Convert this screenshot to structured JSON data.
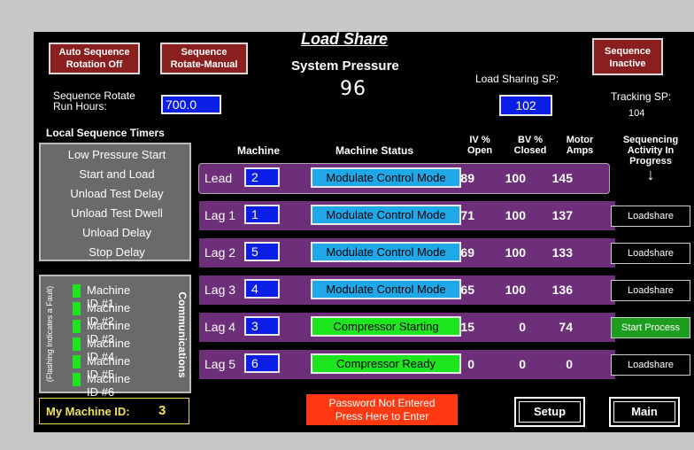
{
  "top_buttons": {
    "auto_sequence": [
      "Auto Sequence",
      "Rotation Off"
    ],
    "sequence_rotate": [
      "Sequence",
      "Rotate-Manual"
    ],
    "sequence_inactive": [
      "Sequence",
      "Inactive"
    ]
  },
  "title": "Load Share",
  "system_pressure": {
    "label": "System Pressure",
    "value": "96"
  },
  "sequence_rotate_hours": {
    "label_line1": "Sequence Rotate",
    "label_line2": "Run Hours:",
    "value": "700.0"
  },
  "load_sharing_sp": {
    "label": "Load Sharing SP:",
    "value": "102"
  },
  "tracking_sp": {
    "label": "Tracking SP:",
    "value": "104"
  },
  "timers": {
    "title": "Local Sequence Timers",
    "items": [
      "Low Pressure Start",
      "Start and Load",
      "Unload Test Delay",
      "Unload Test Dwell",
      "Unload Delay",
      "Stop Delay"
    ]
  },
  "communications": {
    "side_label": "Communications",
    "fault_note": "(Flashing Indicates a Fault)",
    "machines": [
      "Machine ID #1",
      "Machine ID #2",
      "Machine ID #3",
      "Machine ID #4",
      "Machine ID #5",
      "Machine ID #6"
    ],
    "indicator_color": "#1ee61e"
  },
  "my_machine": {
    "label": "My Machine ID:",
    "value": "3"
  },
  "table": {
    "headers": {
      "machine": "Machine",
      "status": "Machine Status",
      "iv": [
        "IV %",
        "Open"
      ],
      "bv": [
        "BV %",
        "Closed"
      ],
      "amps": [
        "Motor",
        "Amps"
      ],
      "activity": [
        "Sequencing",
        "Activity In",
        "Progress"
      ],
      "arrow": "↓"
    },
    "rows": [
      {
        "position": "Lead",
        "machine": "2",
        "status": "Modulate Control Mode",
        "status_color": "#1fa8e8",
        "iv": "89",
        "bv": "100",
        "amps": "145",
        "activity": ""
      },
      {
        "position": "Lag 1",
        "machine": "1",
        "status": "Modulate Control Mode",
        "status_color": "#1fa8e8",
        "iv": "71",
        "bv": "100",
        "amps": "137",
        "activity": "Loadshare"
      },
      {
        "position": "Lag 2",
        "machine": "5",
        "status": "Modulate Control Mode",
        "status_color": "#1fa8e8",
        "iv": "69",
        "bv": "100",
        "amps": "133",
        "activity": "Loadshare"
      },
      {
        "position": "Lag 3",
        "machine": "4",
        "status": "Modulate Control Mode",
        "status_color": "#1fa8e8",
        "iv": "65",
        "bv": "100",
        "amps": "136",
        "activity": "Loadshare"
      },
      {
        "position": "Lag 4",
        "machine": "3",
        "status": "Compressor Starting",
        "status_color": "#1ee61e",
        "iv": "15",
        "bv": "0",
        "amps": "74",
        "activity": "Start Process"
      },
      {
        "position": "Lag 5",
        "machine": "6",
        "status": "Compressor Ready",
        "status_color": "#1ee61e",
        "iv": "0",
        "bv": "0",
        "amps": "0",
        "activity": "Loadshare"
      }
    ]
  },
  "password": [
    "Password Not Entered",
    "Press Here to Enter"
  ],
  "nav": {
    "setup": "Setup",
    "main": "Main"
  }
}
